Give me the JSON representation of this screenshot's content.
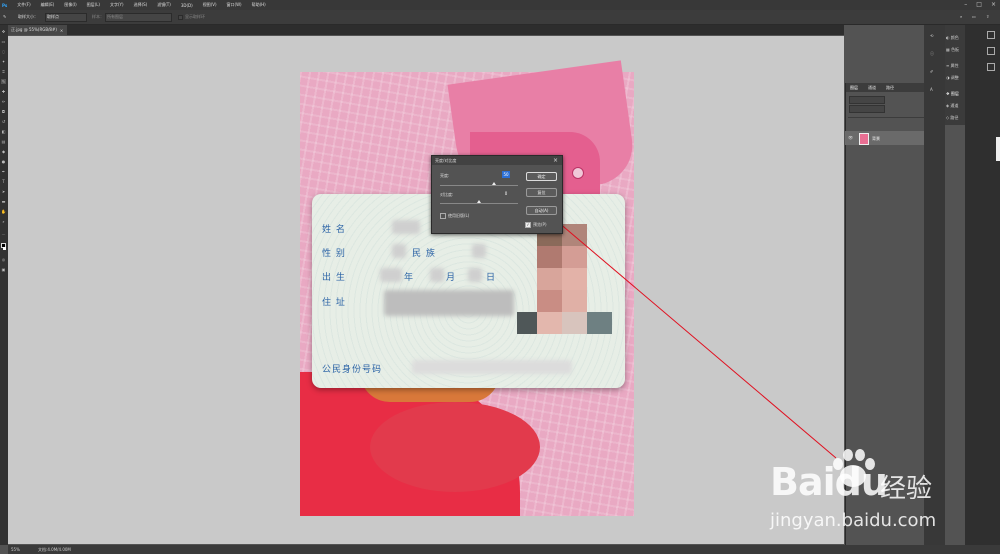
{
  "menu": [
    "文件(F)",
    "编辑(E)",
    "图像(I)",
    "图层(L)",
    "文字(Y)",
    "选择(S)",
    "滤镜(T)",
    "3D(D)",
    "视图(V)",
    "窗口(W)",
    "帮助(H)"
  ],
  "window_controls": {
    "minimize": "–",
    "maximize": "□",
    "close": "×"
  },
  "options": {
    "sample_size_label": "取样大小：",
    "sample_size_value": "取样点",
    "sample_label": "样本：",
    "sample_value": "所有图层",
    "show_ring": "显示取样环"
  },
  "document": {
    "tab_label": "正.jpg @ 55%(RGB/8#)",
    "zoom": "55%",
    "doc_size": "文档:4.0M/4.00M"
  },
  "dialog": {
    "title": "亮度/对比度",
    "brightness_label": "亮度:",
    "brightness_value": "50",
    "brightness_fraction": 0.69,
    "contrast_label": "对比度:",
    "contrast_value": "0",
    "contrast_fraction": 0.5,
    "ok": "确定",
    "reset": "复位",
    "auto": "自动(A)",
    "use_legacy": "使用旧版(L)",
    "preview": "预览(P)",
    "preview_checked": true
  },
  "idcard": {
    "name": "姓 名",
    "sex": "性 别",
    "ethnicity": "民 族",
    "birth": "出 生",
    "year": "年",
    "month": "月",
    "day": "日",
    "address": "住 址",
    "id_number": "公民身份号码"
  },
  "panels": {
    "dock_items": [
      "颜色",
      "色板",
      "属性",
      "调整",
      "图层",
      "通道",
      "路径"
    ],
    "layers_tabs": [
      "图层",
      "通道",
      "路径"
    ],
    "layer_name": "背景"
  },
  "watermark": {
    "brand": "Baidu",
    "cn": "经验",
    "url": "jingyan.baidu.com"
  }
}
